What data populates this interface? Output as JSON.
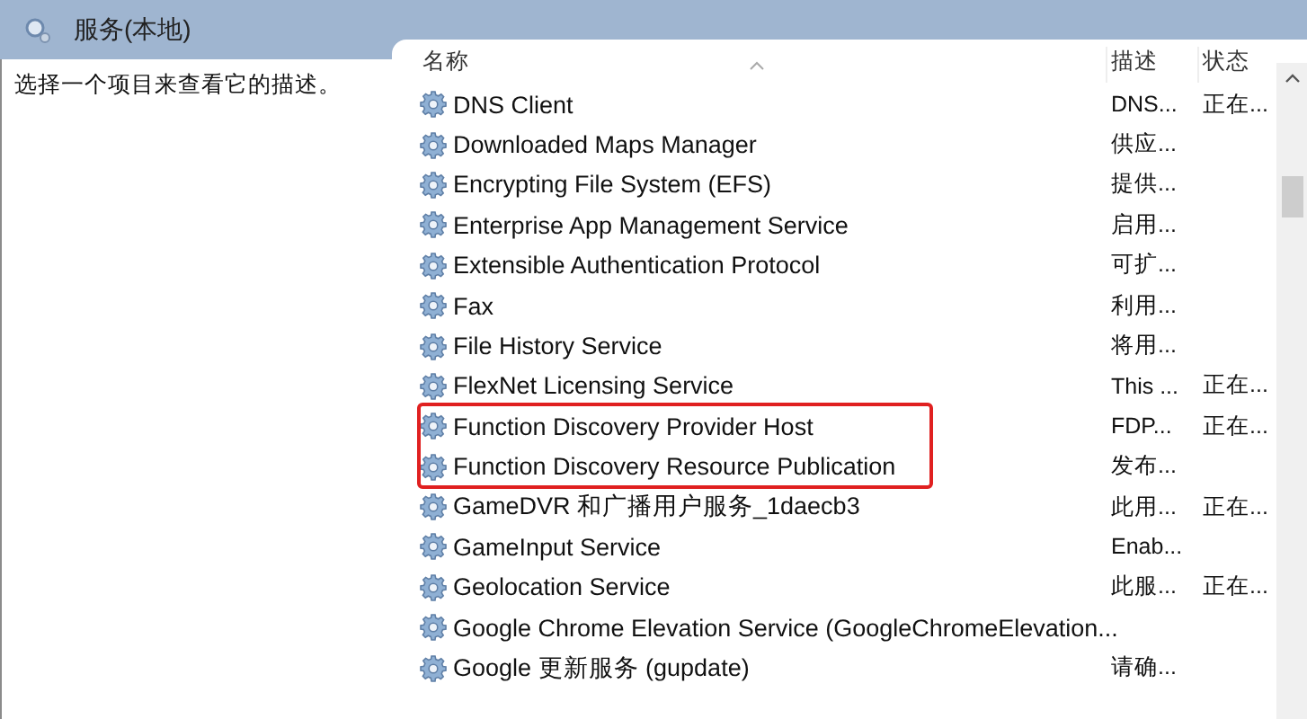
{
  "window": {
    "title": "服务(本地)"
  },
  "description_pane": {
    "text": "选择一个项目来查看它的描述。"
  },
  "table": {
    "columns": [
      "名称",
      "描述",
      "状态"
    ],
    "rows": [
      {
        "name": "DNS Client",
        "description": "DNS...",
        "status": "正在...",
        "highlighted": false
      },
      {
        "name": "Downloaded Maps Manager",
        "description": "供应...",
        "highlighted": false
      },
      {
        "name": "Encrypting File System (EFS)",
        "description": "提供...",
        "highlighted": false
      },
      {
        "name": "Enterprise App Management Service",
        "description": "启用...",
        "highlighted": false
      },
      {
        "name": "Extensible Authentication Protocol",
        "description": "可扩...",
        "highlighted": false
      },
      {
        "name": "Fax",
        "description": "利用...",
        "highlighted": false
      },
      {
        "name": "File History Service",
        "description": "将用...",
        "highlighted": false
      },
      {
        "name": "FlexNet Licensing Service",
        "description": "This ...",
        "status": "正在...",
        "highlighted": false
      },
      {
        "name": "Function Discovery Provider Host",
        "description": "FDP...",
        "status": "正在...",
        "highlighted": true
      },
      {
        "name": "Function Discovery Resource Publication",
        "description": "发布...",
        "highlighted": true
      },
      {
        "name": "GameDVR 和广播用户服务_1daecb3",
        "description": "此用...",
        "status": "正在...",
        "highlighted": false
      },
      {
        "name": "GameInput Service",
        "description": "Enab...",
        "highlighted": false
      },
      {
        "name": "Geolocation Service",
        "description": "此服...",
        "status": "正在...",
        "highlighted": false
      },
      {
        "name": "Google Chrome Elevation Service (GoogleChromeElevation...",
        "highlighted": false
      },
      {
        "name": "Google 更新服务 (gupdate)",
        "description": "请确...",
        "highlighted": false
      }
    ]
  }
}
